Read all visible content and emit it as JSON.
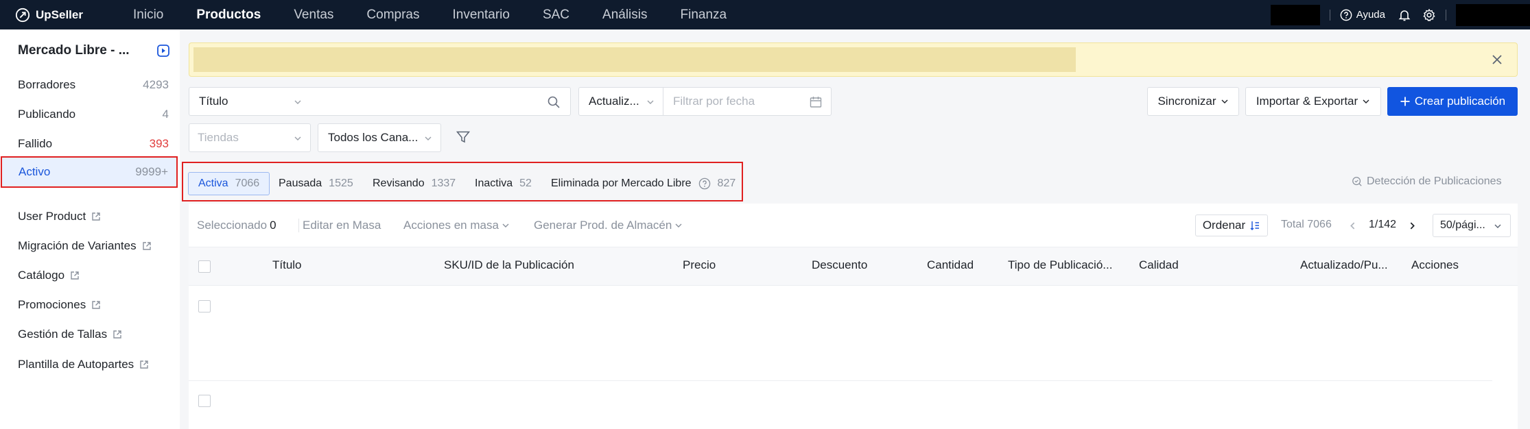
{
  "app": {
    "logo_text": "UpSeller",
    "nav": [
      "Inicio",
      "Productos",
      "Ventas",
      "Compras",
      "Inventario",
      "SAC",
      "Análisis",
      "Finanza"
    ],
    "active_nav": "Productos",
    "help_label": "Ayuda"
  },
  "sidebar": {
    "store_title": "Mercado Libre - ...",
    "status_items": [
      {
        "label": "Borradores",
        "count": "4293"
      },
      {
        "label": "Publicando",
        "count": "4"
      },
      {
        "label": "Fallido",
        "count": "393"
      },
      {
        "label": "Activo",
        "count": "9999+"
      }
    ],
    "links": [
      "User Product",
      "Migración de Variantes",
      "Catálogo",
      "Promociones",
      "Gestión de Tallas",
      "Plantilla de Autopartes"
    ]
  },
  "filters": {
    "search_field_select": "Título",
    "search_placeholder": "",
    "date_type_select": "Actualiz...",
    "date_placeholder": "Filtrar por fecha",
    "stores_placeholder": "Tiendas",
    "channels_select": "Todos los Cana..."
  },
  "actions": {
    "sync_label": "Sincronizar",
    "import_export_label": "Importar & Exportar",
    "create_label": "Crear publicación"
  },
  "status_tabs": [
    {
      "label": "Activa",
      "count": "7066"
    },
    {
      "label": "Pausada",
      "count": "1525"
    },
    {
      "label": "Revisando",
      "count": "1337"
    },
    {
      "label": "Inactiva",
      "count": "52"
    },
    {
      "label": "Eliminada por Mercado Libre",
      "count": "827"
    }
  ],
  "detect_label": "Detección de Publicaciones",
  "toolbar": {
    "selected_label": "Seleccionado",
    "selected_count": "0",
    "bulk_edit": "Editar en Masa",
    "bulk_actions": "Acciones en masa",
    "generate_warehouse": "Generar Prod. de Almacén",
    "sort_label": "Ordenar",
    "total_label": "Total 7066",
    "page_indicator": "1/142",
    "page_size": "50/pági..."
  },
  "table": {
    "columns": [
      "Título",
      "SKU/ID de la Publicación",
      "Precio",
      "Descuento",
      "Cantidad",
      "Tipo de Publicació...",
      "Calidad",
      "Actualizado/Pu...",
      "Acciones"
    ]
  }
}
